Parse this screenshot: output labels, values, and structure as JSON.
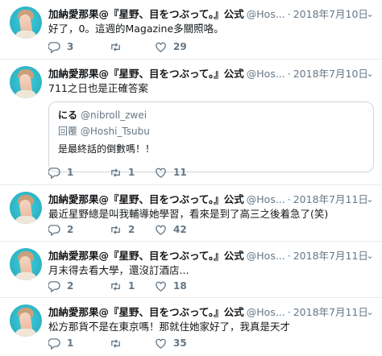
{
  "tweets": [
    {
      "name": "加納愛那果@『星野、目をつぶって。』公式",
      "handle": "@Hos...",
      "date": "2018年7月10日",
      "text": "好了，0。這週的Magazine多關照咯。",
      "replies": "3",
      "retweets": "",
      "likes": "29"
    },
    {
      "name": "加納愛那果@『星野、目をつぶって。』公式",
      "handle": "@Hos...",
      "date": "2018年7月10日",
      "text": "711之日也是正確答案",
      "quote": {
        "name": "にる",
        "handle": "@nibroll_zwei",
        "reply_prefix": "回覆",
        "reply_to": "@Hoshi_Tsubu",
        "text": "是最終話的倒數嗎！！"
      },
      "replies": "1",
      "retweets": "1",
      "likes": "11"
    },
    {
      "name": "加納愛那果@『星野、目をつぶって。』公式",
      "handle": "@Hos...",
      "date": "2018年7月11日",
      "text": "最近星野總是叫我輔導她學習，看來是到了高三之後着急了(笑)",
      "replies": "2",
      "retweets": "2",
      "likes": "42"
    },
    {
      "name": "加納愛那果@『星野、目をつぶって。』公式",
      "handle": "@Hos...",
      "date": "2018年7月11日",
      "text": "月末得去看大學，還沒訂酒店...",
      "replies": "2",
      "retweets": "1",
      "likes": "18"
    },
    {
      "name": "加納愛那果@『星野、目をつぶって。』公式",
      "handle": "@Hos...",
      "date": "2018年7月11日",
      "text": "松方那貨不是在東京嗎！那就住她家好了，我真是天才",
      "replies": "1",
      "retweets": "",
      "likes": "35"
    }
  ],
  "icons": {
    "reply": "reply-icon",
    "retweet": "retweet-icon",
    "like": "heart-icon",
    "menu": "chevron-down-icon"
  },
  "colors": {
    "text": "#14171a",
    "muted": "#657786",
    "divider": "#e6ecf0",
    "avatar_bg": "#2fb8c9"
  }
}
